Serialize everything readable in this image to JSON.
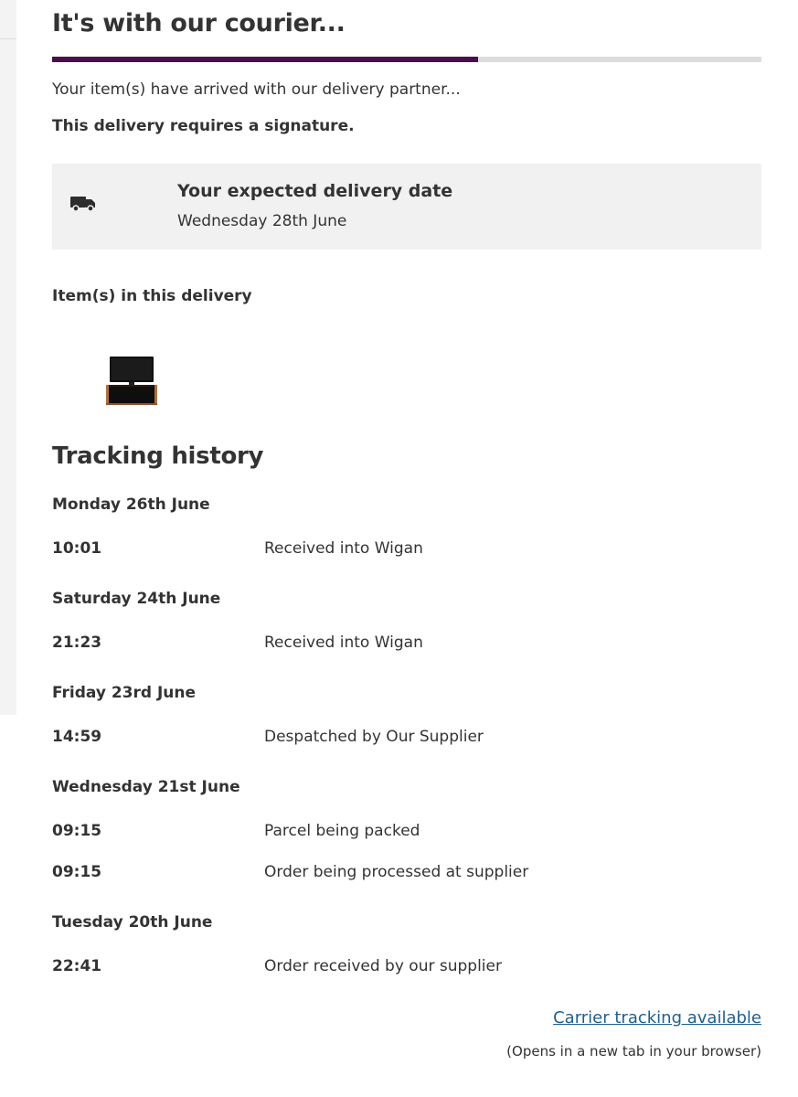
{
  "header": {
    "title": "It's with our courier...",
    "progress_fraction": 0.6
  },
  "status": {
    "message": "Your item(s) have arrived with our delivery partner...",
    "signature_note": "This delivery requires a signature."
  },
  "delivery": {
    "icon": "truck-icon",
    "heading": "Your expected delivery date",
    "date": "Wednesday 28th June"
  },
  "items": {
    "heading": "Item(s) in this delivery",
    "thumbnail": "tv-cabinet-image"
  },
  "tracking": {
    "heading": "Tracking history",
    "days": [
      {
        "date": "Monday 26th June",
        "events": [
          {
            "time": "10:01",
            "description": "Received into Wigan"
          }
        ]
      },
      {
        "date": "Saturday 24th June",
        "events": [
          {
            "time": "21:23",
            "description": "Received into Wigan"
          }
        ]
      },
      {
        "date": "Friday 23rd June",
        "events": [
          {
            "time": "14:59",
            "description": "Despatched by Our Supplier"
          }
        ]
      },
      {
        "date": "Wednesday 21st June",
        "events": [
          {
            "time": "09:15",
            "description": "Parcel being packed"
          },
          {
            "time": "09:15",
            "description": "Order being processed at supplier"
          }
        ]
      },
      {
        "date": "Tuesday 20th June",
        "events": [
          {
            "time": "22:41",
            "description": "Order received by our supplier"
          }
        ]
      }
    ]
  },
  "footer": {
    "carrier_link": "Carrier tracking available",
    "new_tab_note": "(Opens in a new tab in your browser)"
  },
  "colors": {
    "progress_fill": "#4a0f4a",
    "progress_track": "#dddddd",
    "link": "#1f5f8f",
    "box_background": "#f1f1f1"
  }
}
